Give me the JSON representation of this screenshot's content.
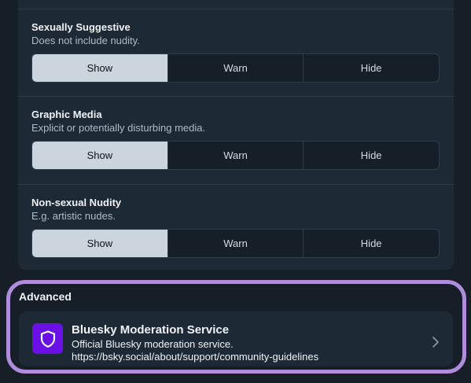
{
  "settings": [
    {
      "title": "Sexually Suggestive",
      "description": "Does not include nudity.",
      "options": [
        "Show",
        "Warn",
        "Hide"
      ],
      "selected": "Show"
    },
    {
      "title": "Graphic Media",
      "description": "Explicit or potentially disturbing media.",
      "options": [
        "Show",
        "Warn",
        "Hide"
      ],
      "selected": "Show"
    },
    {
      "title": "Non-sexual Nudity",
      "description": "E.g. artistic nudes.",
      "options": [
        "Show",
        "Warn",
        "Hide"
      ],
      "selected": "Show"
    }
  ],
  "advanced": {
    "label": "Advanced",
    "service": {
      "name": "Bluesky Moderation Service",
      "description": "Official Bluesky moderation service.",
      "url": "https://bsky.social/about/support/community-guidelines",
      "logo_icon": "shield-icon",
      "logo_color": "#6a0fe6"
    },
    "highlight_color": "#b08ddb"
  },
  "colors": {
    "background": "#161e27",
    "card": "#1e2936",
    "selected_option": "#ccd4dd"
  }
}
